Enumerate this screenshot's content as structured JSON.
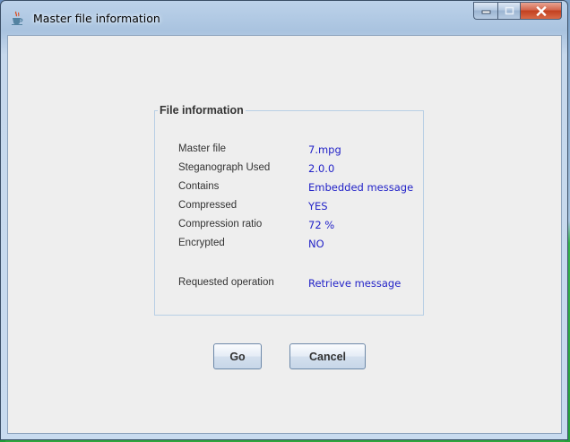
{
  "window": {
    "title": "Master file information",
    "icon": "java-cup-icon"
  },
  "file_information": {
    "legend": "File information",
    "rows": [
      {
        "label": "Master file",
        "value": "7.mpg"
      },
      {
        "label": "Steganograph Used",
        "value": "2.0.0"
      },
      {
        "label": "Contains",
        "value": "Embedded message"
      },
      {
        "label": "Compressed",
        "value": "YES"
      },
      {
        "label": "Compression ratio",
        "value": "72 %"
      },
      {
        "label": "Encrypted",
        "value": "NO"
      }
    ],
    "requested_operation": {
      "label": "Requested operation",
      "value": "Retrieve message"
    }
  },
  "buttons": {
    "go": "Go",
    "cancel": "Cancel"
  },
  "colors": {
    "value_text": "#2323c8",
    "label_text": "#333333",
    "panel_background": "#eeeeee"
  }
}
